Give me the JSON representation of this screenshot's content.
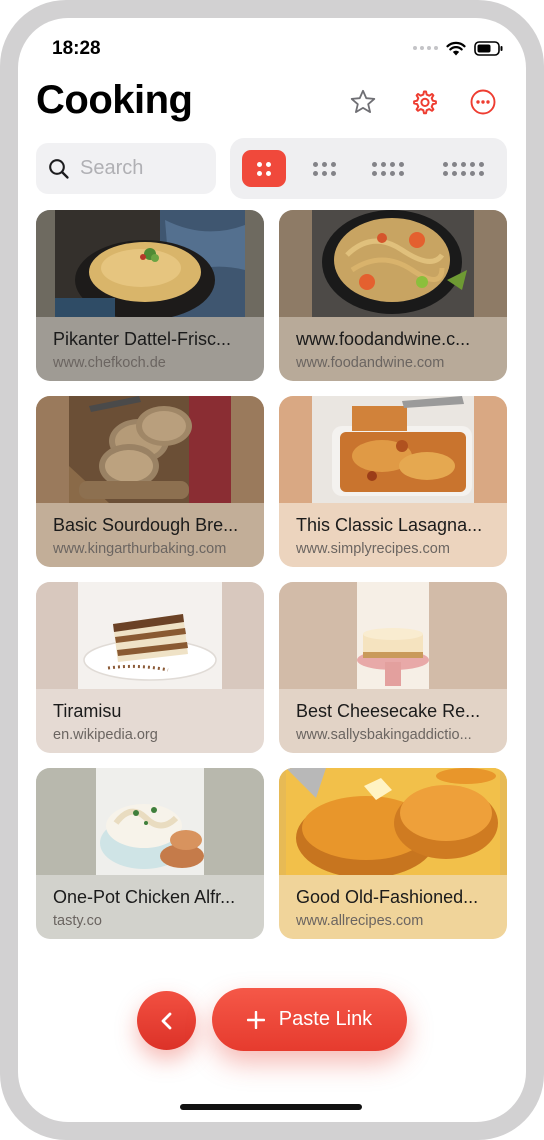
{
  "status_bar": {
    "time": "18:28"
  },
  "header": {
    "title": "Cooking",
    "favorites_icon": "star-outline-icon",
    "settings_icon": "gear-icon",
    "more_icon": "ellipsis-circle-icon"
  },
  "search": {
    "placeholder": "Search",
    "value": ""
  },
  "layout_switcher": {
    "options": [
      "2-column-grid",
      "3-column-grid",
      "4-column-grid",
      "5-column-grid"
    ],
    "selected": "2-column-grid"
  },
  "recipes": [
    {
      "title": "Pikanter Dattel-Frisc...",
      "domain": "www.chefkoch.de",
      "tint": "#9f9b94",
      "image_bg": "#6e6a60"
    },
    {
      "title": "www.foodandwine.c...",
      "domain": "www.foodandwine.com",
      "tint": "#b8aa99",
      "image_bg": "#8e7b66"
    },
    {
      "title": "Basic Sourdough Bre...",
      "domain": "www.kingarthurbaking.com",
      "tint": "#c2ae98",
      "image_bg": "#9a7a5c"
    },
    {
      "title": "This Classic Lasagna...",
      "domain": "www.simplyrecipes.com",
      "tint": "#ecd4be",
      "image_bg": "#d9a883"
    },
    {
      "title": "Tiramisu",
      "domain": "en.wikipedia.org",
      "tint": "#e5dad3",
      "image_bg": "#d8c8be"
    },
    {
      "title": "Best Cheesecake Re...",
      "domain": "www.sallysbakingaddictio...",
      "tint": "#e2d3c6",
      "image_bg": "#d2bba8"
    },
    {
      "title": "One-Pot Chicken Alfr...",
      "domain": "tasty.co",
      "tint": "#d2d2cc",
      "image_bg": "#b8b8ad"
    },
    {
      "title": "Good Old-Fashioned...",
      "domain": "www.allrecipes.com",
      "tint": "#f0d49a",
      "image_bg": "#e7ba55"
    }
  ],
  "bottom_bar": {
    "back_icon": "chevron-left-icon",
    "paste_icon": "plus-icon",
    "paste_label": "Paste Link"
  },
  "colors": {
    "accent": "#f0493b",
    "segment_bg": "#efeff1",
    "search_bg": "#f1f1f3"
  }
}
